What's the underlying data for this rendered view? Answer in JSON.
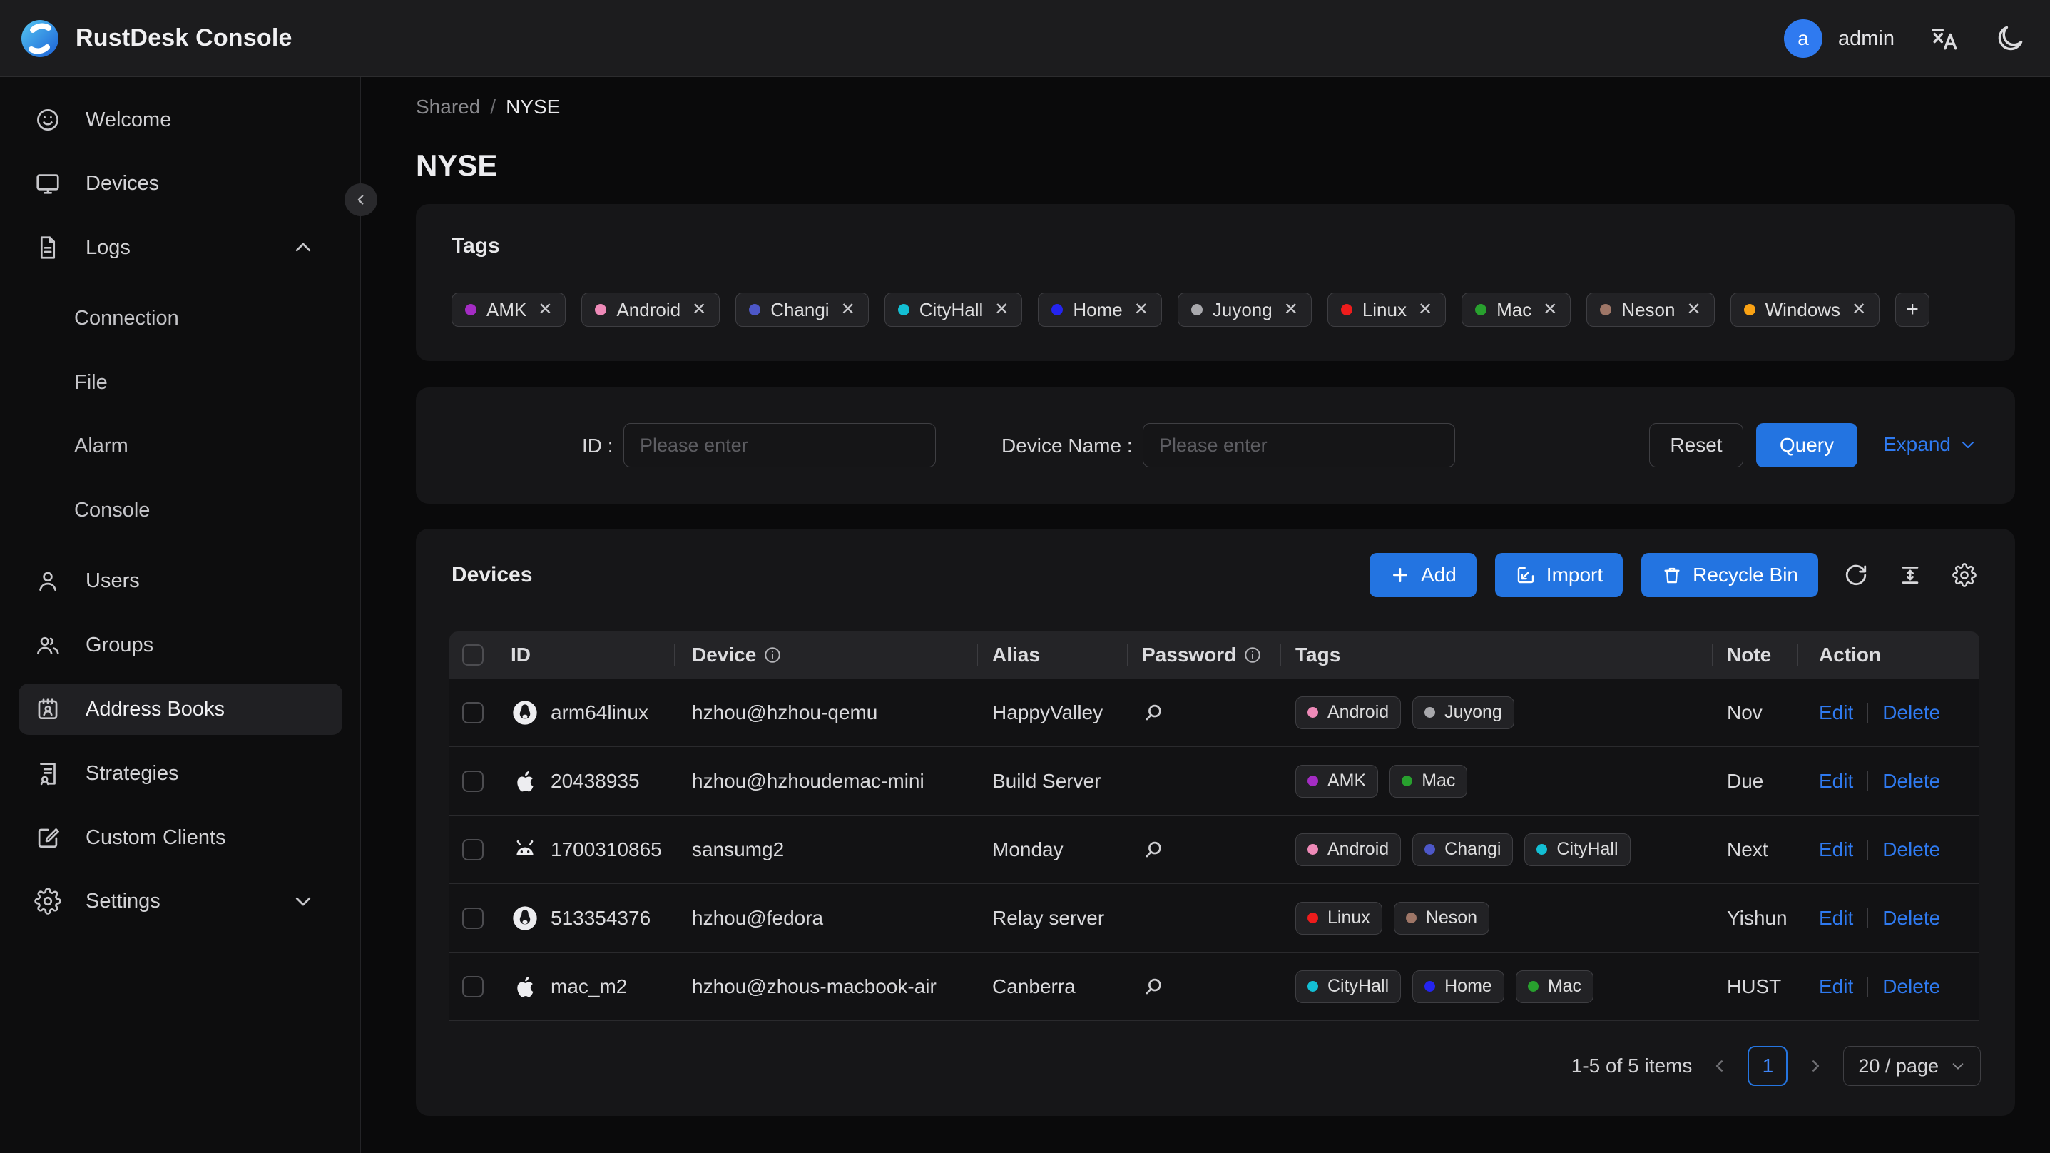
{
  "navbar": {
    "title": "RustDesk Console",
    "user": {
      "initial": "a",
      "name": "admin"
    }
  },
  "sidebar": {
    "items": [
      {
        "icon": "smiley",
        "label": "Welcome"
      },
      {
        "icon": "monitor",
        "label": "Devices"
      },
      {
        "icon": "file-text",
        "label": "Logs",
        "chevron": "up",
        "expanded": true
      },
      {
        "child": true,
        "label": "Connection"
      },
      {
        "child": true,
        "label": "File"
      },
      {
        "child": true,
        "label": "Alarm"
      },
      {
        "child": true,
        "label": "Console"
      },
      {
        "icon": "user",
        "label": "Users"
      },
      {
        "icon": "users-group",
        "label": "Groups"
      },
      {
        "icon": "address-book",
        "label": "Address Books",
        "active": true
      },
      {
        "icon": "strategy",
        "label": "Strategies"
      },
      {
        "icon": "edit-square",
        "label": "Custom Clients"
      },
      {
        "icon": "gear",
        "label": "Settings",
        "chevron": "down"
      }
    ]
  },
  "breadcrumb": {
    "parent": "Shared",
    "separator": "/",
    "current": "NYSE"
  },
  "page_title": "NYSE",
  "tag_colors": {
    "AMK": "#a42cc4",
    "Android": "#ee8ab8",
    "Changi": "#4d57c8",
    "CityHall": "#13bfd4",
    "Home": "#2424f0",
    "Juyong": "#a8a8ac",
    "Linux": "#ee1c1c",
    "Mac": "#28a02e",
    "Neson": "#9e7667",
    "Windows": "#faa214"
  },
  "tags_card": {
    "title": "Tags",
    "tags": [
      "AMK",
      "Android",
      "Changi",
      "CityHall",
      "Home",
      "Juyong",
      "Linux",
      "Mac",
      "Neson",
      "Windows"
    ],
    "add_label": "+"
  },
  "filter": {
    "id_label": "ID :",
    "device_name_label": "Device Name :",
    "placeholder": "Please enter",
    "id_value": "",
    "device_name_value": "",
    "reset_label": "Reset",
    "query_label": "Query",
    "expand_label": "Expand"
  },
  "devices_card": {
    "title": "Devices",
    "buttons": {
      "add": "Add",
      "import": "Import",
      "recycle_bin": "Recycle Bin"
    },
    "columns": {
      "id": "ID",
      "device": "Device",
      "alias": "Alias",
      "password": "Password",
      "tags": "Tags",
      "note": "Note",
      "action": "Action"
    },
    "actions": {
      "edit": "Edit",
      "delete": "Delete"
    },
    "rows": [
      {
        "os": "linux",
        "id": "arm64linux",
        "device": "hzhou@hzhou-qemu",
        "alias": "HappyValley",
        "has_password": true,
        "tags": [
          "Android",
          "Juyong"
        ],
        "note": "Nov"
      },
      {
        "os": "apple",
        "id": "20438935",
        "device": "hzhou@hzhoudemac-mini",
        "alias": "Build Server",
        "has_password": false,
        "tags": [
          "AMK",
          "Mac"
        ],
        "note": "Due"
      },
      {
        "os": "android",
        "id": "1700310865",
        "device": "sansumg2",
        "alias": "Monday",
        "has_password": true,
        "tags": [
          "Android",
          "Changi",
          "CityHall"
        ],
        "note": "Next"
      },
      {
        "os": "linux",
        "id": "513354376",
        "device": "hzhou@fedora",
        "alias": "Relay server",
        "has_password": false,
        "tags": [
          "Linux",
          "Neson"
        ],
        "note": "Yishun"
      },
      {
        "os": "apple",
        "id": "mac_m2",
        "device": "hzhou@zhous-macbook-air",
        "alias": "Canberra",
        "has_password": true,
        "tags": [
          "CityHall",
          "Home",
          "Mac"
        ],
        "note": "HUST"
      }
    ],
    "pagination": {
      "total": "1-5 of 5 items",
      "page": "1",
      "page_size": "20 / page"
    }
  }
}
